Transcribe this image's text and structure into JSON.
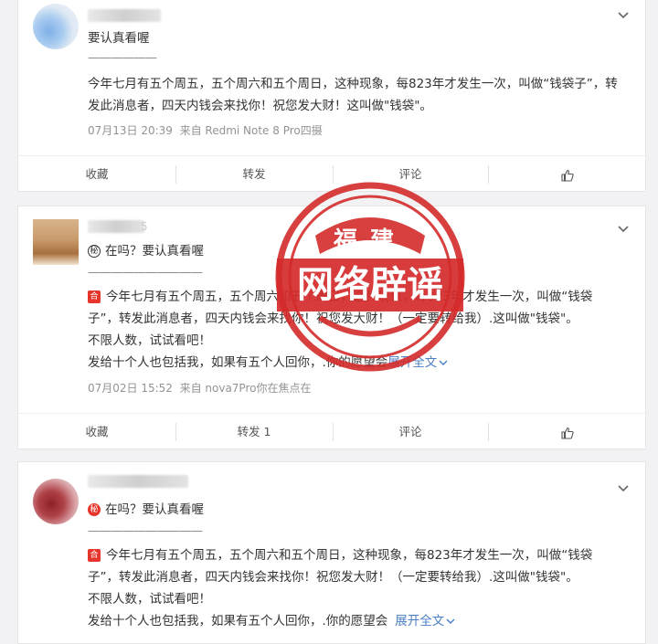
{
  "posts": [
    {
      "first_line": "要认真看喔",
      "divider": "——————",
      "body_line1": "今年七月有五个周五，五个周六和五个周日，这种现象，每823年才发生一次，叫做“钱袋子”，转",
      "body_line2": "发此消息者，四天内钱会来找你！祝您发大财！这叫做\"钱袋\"。",
      "timestamp": "07月13日 20:39",
      "source": "来自 Redmi Note 8 Pro四摄",
      "actions": {
        "collect": "收藏",
        "repost": "转发",
        "comment": "评论"
      }
    },
    {
      "username_tail": "5",
      "first_line": "在吗？要认真看喔",
      "first_badge": "秘",
      "divider": "——————————",
      "body_badge": "合",
      "body_line1": "今年七月有五个周五，五个周六和五个周日，这种现象，每823年才发生一次，叫做“钱袋",
      "body_line2": "子”，转发此消息者，四天内钱会来找你！祝您发大财！（一定要转给我）.这叫做\"钱袋\"。",
      "body_line3": "不限人数，试试看吧！",
      "body_line4": "发给十个人也包括我，如果有五个人回你，.你的愿望会",
      "expand": "展开全文",
      "timestamp": "07月02日 15:52",
      "source": "来自 nova7Pro你在焦点在",
      "actions": {
        "collect": "收藏",
        "repost": "转发 1",
        "comment": "评论"
      }
    },
    {
      "first_line": "在吗？要认真看喔",
      "first_badge": "秘",
      "divider": "——————————",
      "body_badge": "合",
      "body_line1": "今年七月有五个周五，五个周六和五个周日，这种现象，每823年才发生一次，叫做“钱袋",
      "body_line2": "子”，转发此消息者，四天内钱会来找你！祝您发大财！（一定要转给我）.这叫做\"钱袋\"。",
      "body_line3": "不限人数，试试看吧！",
      "body_line4": "发给十个人也包括我，如果有五个人回你，.你的愿望会",
      "expand": "展开全文"
    }
  ],
  "stamp": {
    "top_text": "福建",
    "main_text": "网络辟谣"
  },
  "colors": {
    "stamp_red": "#d42a2a",
    "link_blue": "#4a7ec6",
    "badge_red": "#e6352b"
  },
  "icons": [
    "chevron-down-icon",
    "thumbs-up-icon",
    "expand-chevron-icon"
  ]
}
